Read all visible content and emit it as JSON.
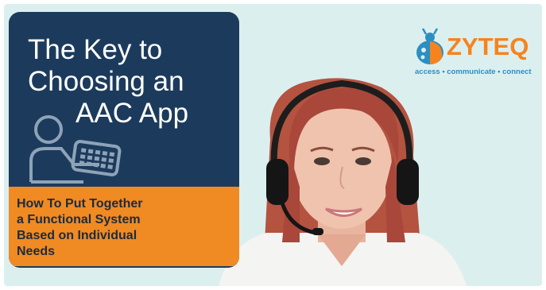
{
  "title_card": {
    "title_lines": [
      "The Key to",
      "Choosing an",
      "AAC App"
    ],
    "subtitle_lines": [
      "How To Put Together",
      "a Functional System",
      "Based on Individual",
      "Needs"
    ]
  },
  "logo": {
    "wordmark": "ZYTEQ",
    "tagline": "access • communicate • connect"
  },
  "colors": {
    "card_navy": "#1c3b5c",
    "band_orange": "#f08a22",
    "logo_orange": "#f5841f",
    "logo_blue": "#2b8fc2",
    "background": "#dcefef"
  }
}
